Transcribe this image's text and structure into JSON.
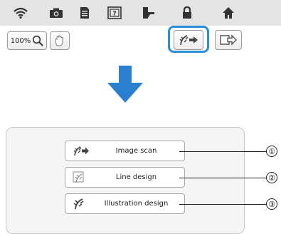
{
  "top_bar": {
    "icons": [
      "wifi-icon",
      "camera-icon",
      "document-icon",
      "help-icon",
      "thread-icon",
      "lock-icon",
      "home-icon"
    ]
  },
  "toolbar": {
    "zoom_label": "100%",
    "scan_icon": "scan-import-icon",
    "export_icon": "export-arrow-icon",
    "highlight_color": "#2b8fd6"
  },
  "arrow_color": "#2b7fd1",
  "menu": {
    "items": [
      {
        "label": "Image scan",
        "icon": "image-scan-icon",
        "callout": "①"
      },
      {
        "label": "Line design",
        "icon": "line-design-icon",
        "callout": "②"
      },
      {
        "label": "Illustration design",
        "icon": "illustration-design-icon",
        "callout": "③"
      }
    ]
  }
}
